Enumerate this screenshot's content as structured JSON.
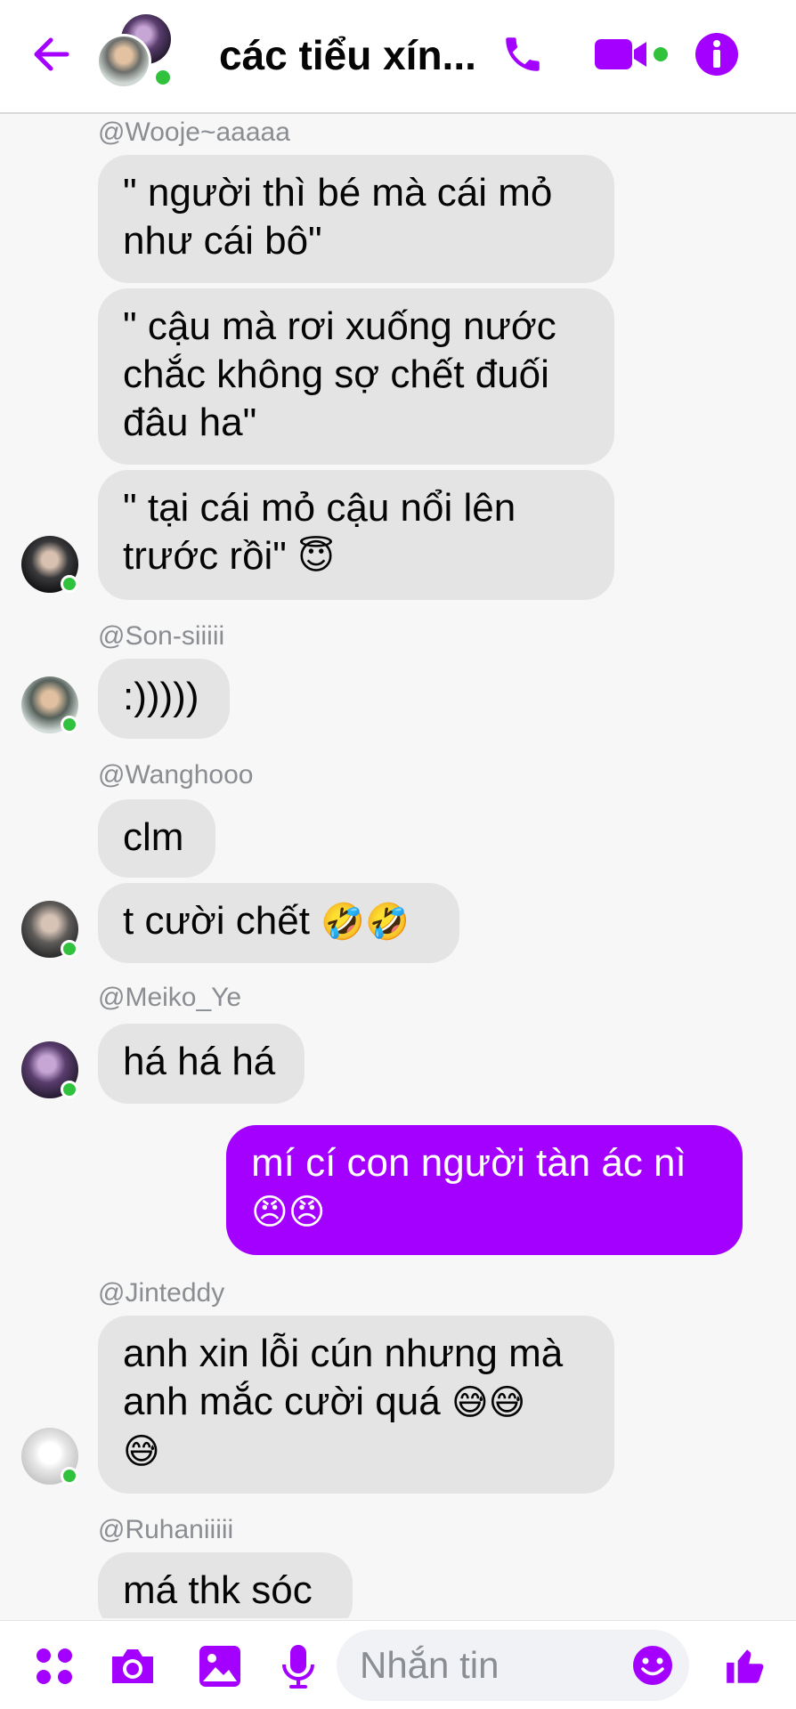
{
  "header": {
    "title": "các tiểu xín...",
    "accent_color": "#a300ff"
  },
  "messages": [
    {
      "sender": "@Wooje~aaaaa",
      "bubbles": [
        {
          "text": "\" người thì bé mà cái mỏ\nnhư cái bô\""
        },
        {
          "text": "\" cậu mà rơi xuống nước\nchắc không sợ chết đuối\nđâu ha\""
        },
        {
          "text": "\" tại cái mỏ cậu nổi lên\ntrước rồi\" ",
          "emoji": "😇"
        }
      ]
    },
    {
      "sender": "@Son-siiiii",
      "bubbles": [
        {
          "text": ":)))))"
        }
      ]
    },
    {
      "sender": "@Wanghooo",
      "bubbles": [
        {
          "text": "clm"
        },
        {
          "text": "t cười chết ",
          "emoji": "🤣🤣"
        }
      ]
    },
    {
      "sender": "@Meiko_Ye",
      "bubbles": [
        {
          "text": "há há há"
        }
      ]
    },
    {
      "outgoing": true,
      "bubbles": [
        {
          "text": "mí cí con người tàn ác nì\n",
          "emoji": "😠😠"
        }
      ]
    },
    {
      "sender": "@Jinteddy",
      "bubbles": [
        {
          "text": "anh xin lỗi cún nhưng mà\nanh mắc cười quá ",
          "emoji": "😅😅\n😅"
        }
      ]
    },
    {
      "sender": "@Ruhaniiiii",
      "bubbles": [
        {
          "text": "má thk sóc"
        }
      ]
    }
  ],
  "composer": {
    "placeholder": "Nhắn tin"
  },
  "icons": [
    "back-arrow-icon",
    "phone-icon",
    "video-camera-icon",
    "info-icon",
    "apps-grid-icon",
    "camera-icon",
    "image-icon",
    "microphone-icon",
    "smiley-icon",
    "thumbs-up-icon"
  ]
}
